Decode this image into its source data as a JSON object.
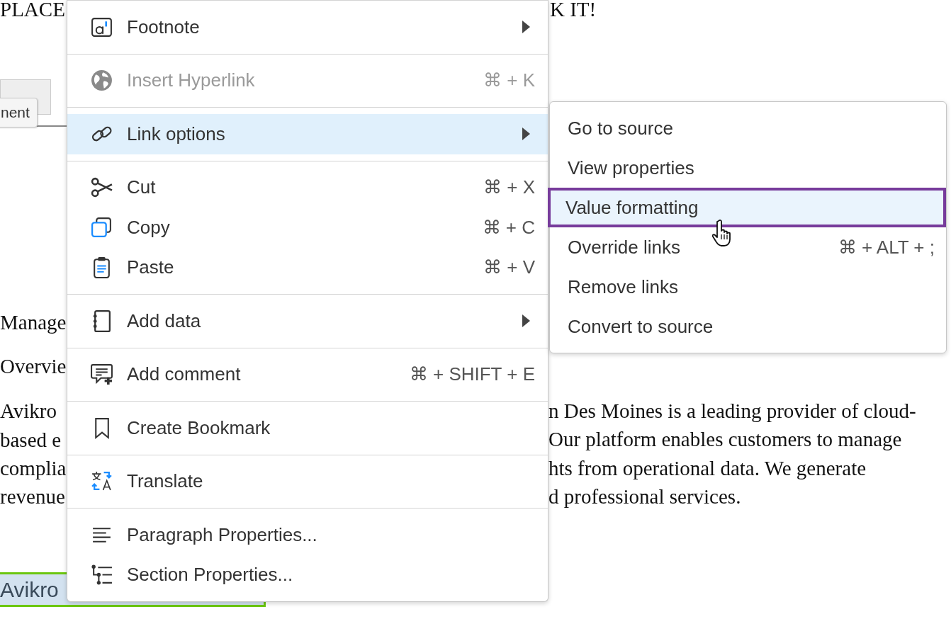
{
  "document": {
    "top_fragments": [
      "PLACE",
      "K IT!"
    ],
    "tooltip": "nent",
    "left_fragments": [
      "Manage",
      "Overvie",
      "Avikro",
      "based e",
      "complia",
      "revenue"
    ],
    "right_fragments": [
      "n Des Moines is a leading provider of cloud-",
      "Our platform enables customers to manage",
      "hts from operational data. We generate",
      "d professional services."
    ],
    "selected_text": "Avikro"
  },
  "context_menu": {
    "groups": [
      {
        "items": [
          {
            "label": "Footnote",
            "has_submenu": true,
            "disabled": false,
            "selected": false
          }
        ]
      },
      {
        "items": [
          {
            "label": "Insert Hyperlink",
            "shortcut": "⌘ + K",
            "has_submenu": false,
            "disabled": true,
            "selected": false
          }
        ]
      },
      {
        "items": [
          {
            "label": "Link options",
            "has_submenu": true,
            "disabled": false,
            "selected": true
          }
        ]
      },
      {
        "items": [
          {
            "label": "Cut",
            "shortcut": "⌘ + X",
            "has_submenu": false,
            "disabled": false,
            "selected": false
          },
          {
            "label": "Copy",
            "shortcut": "⌘ + C",
            "has_submenu": false,
            "disabled": false,
            "selected": false
          },
          {
            "label": "Paste",
            "shortcut": "⌘ + V",
            "has_submenu": false,
            "disabled": false,
            "selected": false
          }
        ]
      },
      {
        "items": [
          {
            "label": "Add data",
            "has_submenu": true,
            "disabled": false,
            "selected": false
          }
        ]
      },
      {
        "items": [
          {
            "label": "Add comment",
            "shortcut": "⌘ + SHIFT + E",
            "has_submenu": false,
            "disabled": false,
            "selected": false
          }
        ]
      },
      {
        "items": [
          {
            "label": "Create Bookmark",
            "has_submenu": false,
            "disabled": false,
            "selected": false
          }
        ]
      },
      {
        "items": [
          {
            "label": "Translate",
            "has_submenu": false,
            "disabled": false,
            "selected": false
          }
        ]
      },
      {
        "items": [
          {
            "label": "Paragraph Properties...",
            "has_submenu": false,
            "disabled": false,
            "selected": false
          },
          {
            "label": "Section Properties...",
            "has_submenu": false,
            "disabled": false,
            "selected": false
          }
        ]
      }
    ]
  },
  "submenu": {
    "items": [
      {
        "label": "Go to source",
        "selected": false
      },
      {
        "label": "View properties",
        "selected": false
      },
      {
        "label": "Value formatting",
        "selected": true
      },
      {
        "label": "Override links",
        "shortcut": "⌘ + ALT + ;",
        "selected": false
      },
      {
        "label": "Remove links",
        "selected": false
      },
      {
        "label": "Convert to source",
        "selected": false
      }
    ]
  }
}
